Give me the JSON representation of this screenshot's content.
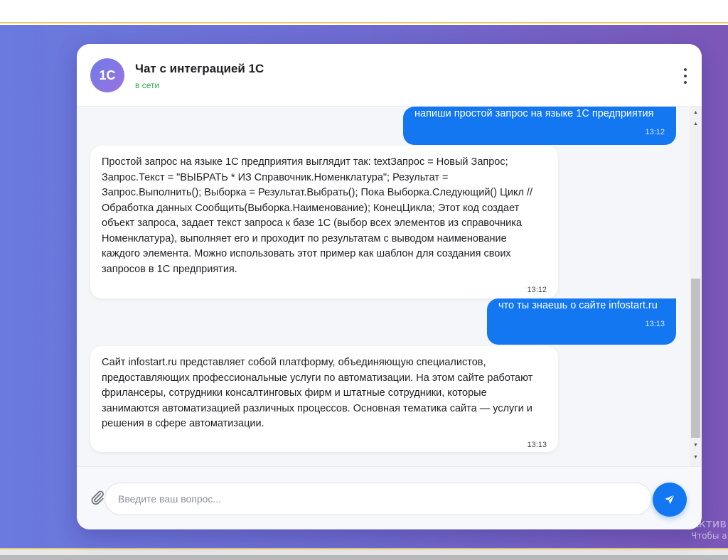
{
  "header": {
    "avatar_text": "1C",
    "title": "Чат с интеграцией 1С",
    "status": "в сети",
    "menu_icon": "more-vertical-icon"
  },
  "messages": [
    {
      "sender": "user",
      "text": "напиши простой запрос на языке 1С предприятия",
      "time": "13:12"
    },
    {
      "sender": "bot",
      "text": "Простой запрос на языке 1С предприятия выглядит так: textЗапрос = Новый Запрос; Запрос.Текст = \"ВЫБРАТЬ * ИЗ Справочник.Номенклатура\"; Результат = Запрос.Выполнить(); Выборка = Результат.Выбрать(); Пока Выборка.Следующий() Цикл // Обработка данных Сообщить(Выборка.Наименование); КонецЦикла; Этот код создает объект запроса, задает текст запроса к базе 1С (выбор всех элементов из справочника Номенклатура), выполняет его и проходит по результатам с выводом наименование каждого элемента. Можно использовать этот пример как шаблон для создания своих запросов в 1С предприятия.",
      "time": "13:12"
    },
    {
      "sender": "user",
      "text": "что ты знаешь о сайте infostart.ru",
      "time": "13:13"
    },
    {
      "sender": "bot",
      "text": "Сайт infostart.ru представляет собой платформу, объединяющую специалистов, предоставляющих профессиональные услуги по автоматизации. На этом сайте работают фрилансеры, сотрудники консалтинговых фирм и штатные сотрудники, которые занимаются автоматизацией различных процессов. Основная тематика сайта — услуги и решения в сфере автоматизации.",
      "time": "13:13"
    }
  ],
  "input": {
    "placeholder": "Введите ваш вопрос...",
    "value": "",
    "attach_icon": "paperclip-icon",
    "send_icon": "send-icon"
  },
  "colors": {
    "accent": "#1277f0",
    "status_online": "#2eab4a",
    "background_gradient_start": "#6a7ade",
    "background_gradient_end": "#7b57b8"
  },
  "watermark": {
    "line1": "Актив",
    "line2": "Чтобы а"
  }
}
